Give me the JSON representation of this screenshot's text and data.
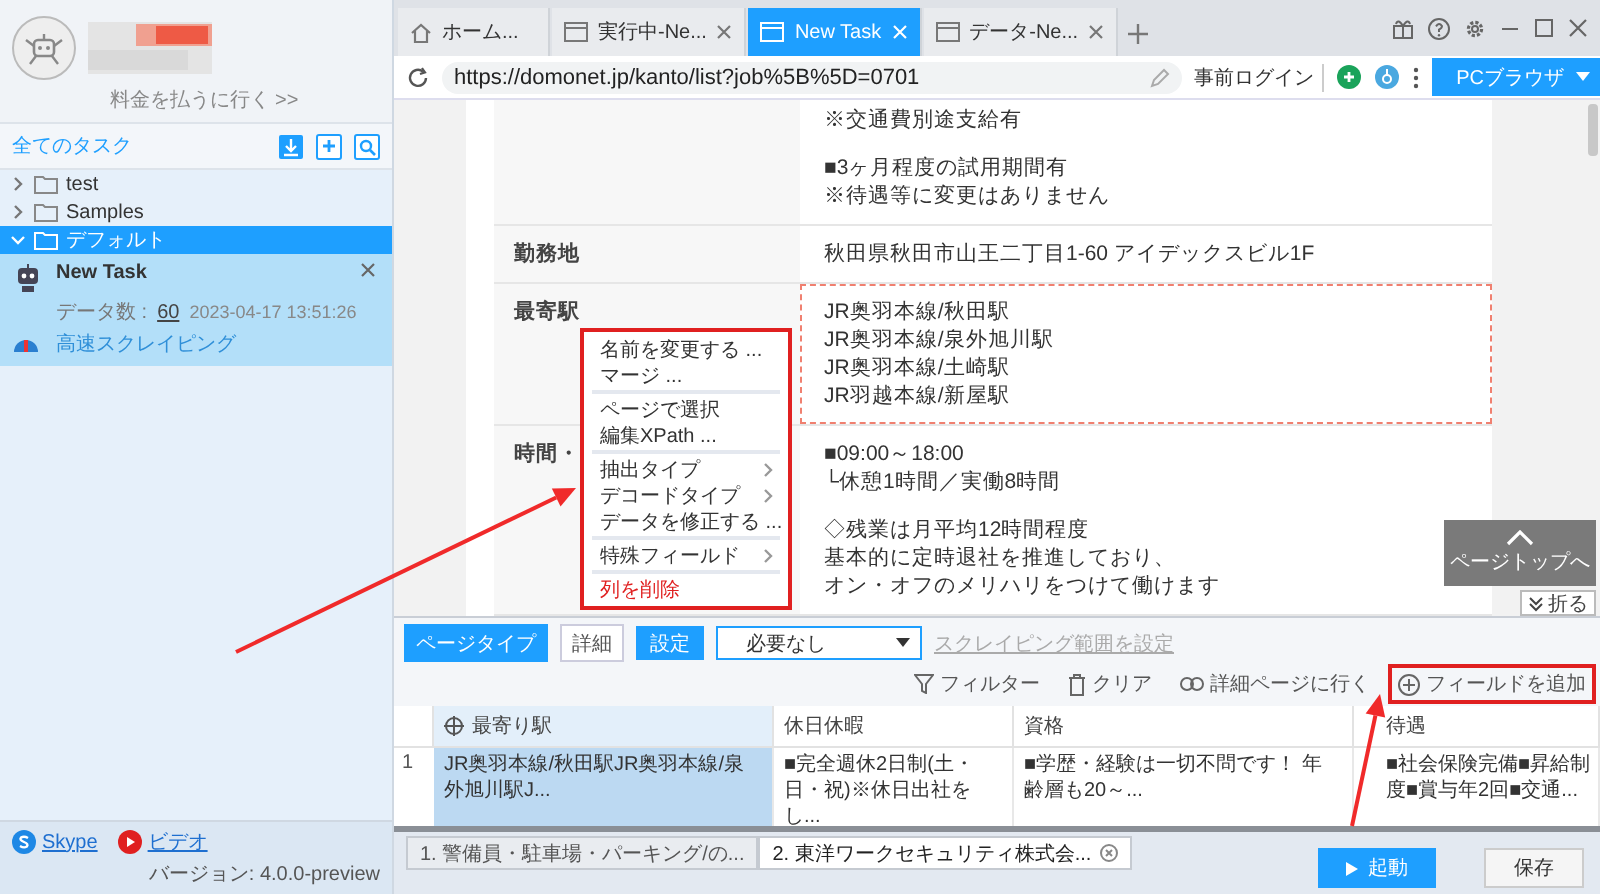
{
  "sidebar": {
    "account_link": "料金を払うに行く >>",
    "all_tasks_label": "全てのタスク",
    "folders": [
      {
        "name": "test",
        "expanded": false,
        "selected": false
      },
      {
        "name": "Samples",
        "expanded": false,
        "selected": false
      },
      {
        "name": "デフォルト",
        "expanded": true,
        "selected": true,
        "children": [
          {
            "name": "New Task",
            "count_label": "データ数 :",
            "count": "60",
            "time": "2023-04-17 13:51:26",
            "mode": "高速スクレイピング"
          }
        ]
      }
    ],
    "links": [
      {
        "kind": "skype",
        "label": "Skype"
      },
      {
        "kind": "video",
        "label": "ビデオ"
      }
    ],
    "version": "バージョン: 4.0.0-preview"
  },
  "browser_tabs": [
    {
      "kind": "home",
      "label": "ホーム...",
      "selected": false,
      "closable": false
    },
    {
      "kind": "page",
      "label": "実行中-Ne...",
      "selected": false,
      "closable": true
    },
    {
      "kind": "page",
      "label": "New Task",
      "selected": true,
      "closable": true
    },
    {
      "kind": "page",
      "label": "データ-Ne...",
      "selected": false,
      "closable": true
    }
  ],
  "address_bar": {
    "url": "https://domonet.jp/kanto/list?job%5B%5D=0701",
    "login_button": "事前ログイン",
    "browser_button": "PCブラウザ"
  },
  "page": {
    "rows": [
      {
        "blocks": [
          [
            "※交通費別途支給有"
          ],
          [
            "■3ヶ月程度の試用期間有",
            "※待遇等に変更はありません"
          ]
        ],
        "highlighted": false
      },
      {
        "label": "勤務地",
        "blocks": [
          [
            "秋田県秋田市山王二丁目1-60 アイデックスビル1F"
          ]
        ],
        "highlighted": false
      },
      {
        "label": "最寄駅",
        "blocks": [
          [
            "JR奥羽本線/秋田駅",
            "JR奥羽本線/泉外旭川駅",
            "JR奥羽本線/土崎駅",
            "JR羽越本線/新屋駅"
          ]
        ],
        "highlighted": true
      },
      {
        "label": "時間・",
        "blocks": [
          [
            "■09:00～18:00",
            "└休憩1時間／実働8時間"
          ],
          [
            "◇残業は月平均12時間程度",
            "基本的に定時退社を推進しており、",
            "オン・オフのメリハリをつけて働けます"
          ]
        ],
        "highlighted": false
      }
    ],
    "page_top_button": "ページトップへ",
    "fold_button": "折る"
  },
  "context_menu": {
    "groups": [
      [
        {
          "label": "名前を変更する ...",
          "kind": "action"
        },
        {
          "label": "マージ ...",
          "kind": "action"
        }
      ],
      [
        {
          "label": "ページで選択",
          "kind": "action"
        },
        {
          "label": "編集XPath ...",
          "kind": "action"
        }
      ],
      [
        {
          "label": "抽出タイプ",
          "kind": "submenu"
        },
        {
          "label": "デコードタイプ",
          "kind": "submenu"
        },
        {
          "label": "データを修正する ...",
          "kind": "action"
        }
      ],
      [
        {
          "label": "特殊フィールド",
          "kind": "submenu"
        }
      ],
      [
        {
          "label": "列を削除",
          "kind": "danger"
        }
      ]
    ]
  },
  "field_panel": {
    "tabs": [
      {
        "label": "ページタイプ",
        "selected": true
      },
      {
        "label": "詳細",
        "selected": false
      }
    ],
    "settings_button": "設定",
    "dropdown_value": "必要なし",
    "range_link": {
      "label": "スクレイピング範囲を設定",
      "disabled": true
    },
    "tools": [
      {
        "kind": "filter",
        "label": "フィルター",
        "highlighted": false
      },
      {
        "kind": "trash",
        "label": "クリア",
        "highlighted": false
      },
      {
        "kind": "link",
        "label": "詳細ページに行く",
        "highlighted": false
      },
      {
        "kind": "add",
        "label": "フィールドを追加",
        "highlighted": true
      }
    ],
    "table": {
      "columns": [
        {
          "label": "最寄り駅",
          "selected": true
        },
        {
          "label": "休日休暇",
          "selected": false
        },
        {
          "label": "資格",
          "selected": false
        },
        {
          "label": "待遇",
          "selected": false
        }
      ],
      "rows": [
        {
          "number": "1",
          "cells": [
            "JR奥羽本線/秋田駅JR奥羽本線/泉外旭川駅J...",
            "■完全週休2日制(土・日・祝)※休日出社をし...",
            "■学歴・経験は一切不問です！ 年齢層も20～...",
            "■社会保険完備■昇給制度■賞与年2回■交通..."
          ]
        }
      ]
    }
  },
  "task_tabs": [
    {
      "label": "1. 警備員・駐車場・パーキング/の...",
      "selected": false
    },
    {
      "label": "2. 東洋ワークセキュリティ株式会...",
      "selected": true
    }
  ],
  "footer": {
    "start_button": "起動",
    "save_button": "保存"
  }
}
